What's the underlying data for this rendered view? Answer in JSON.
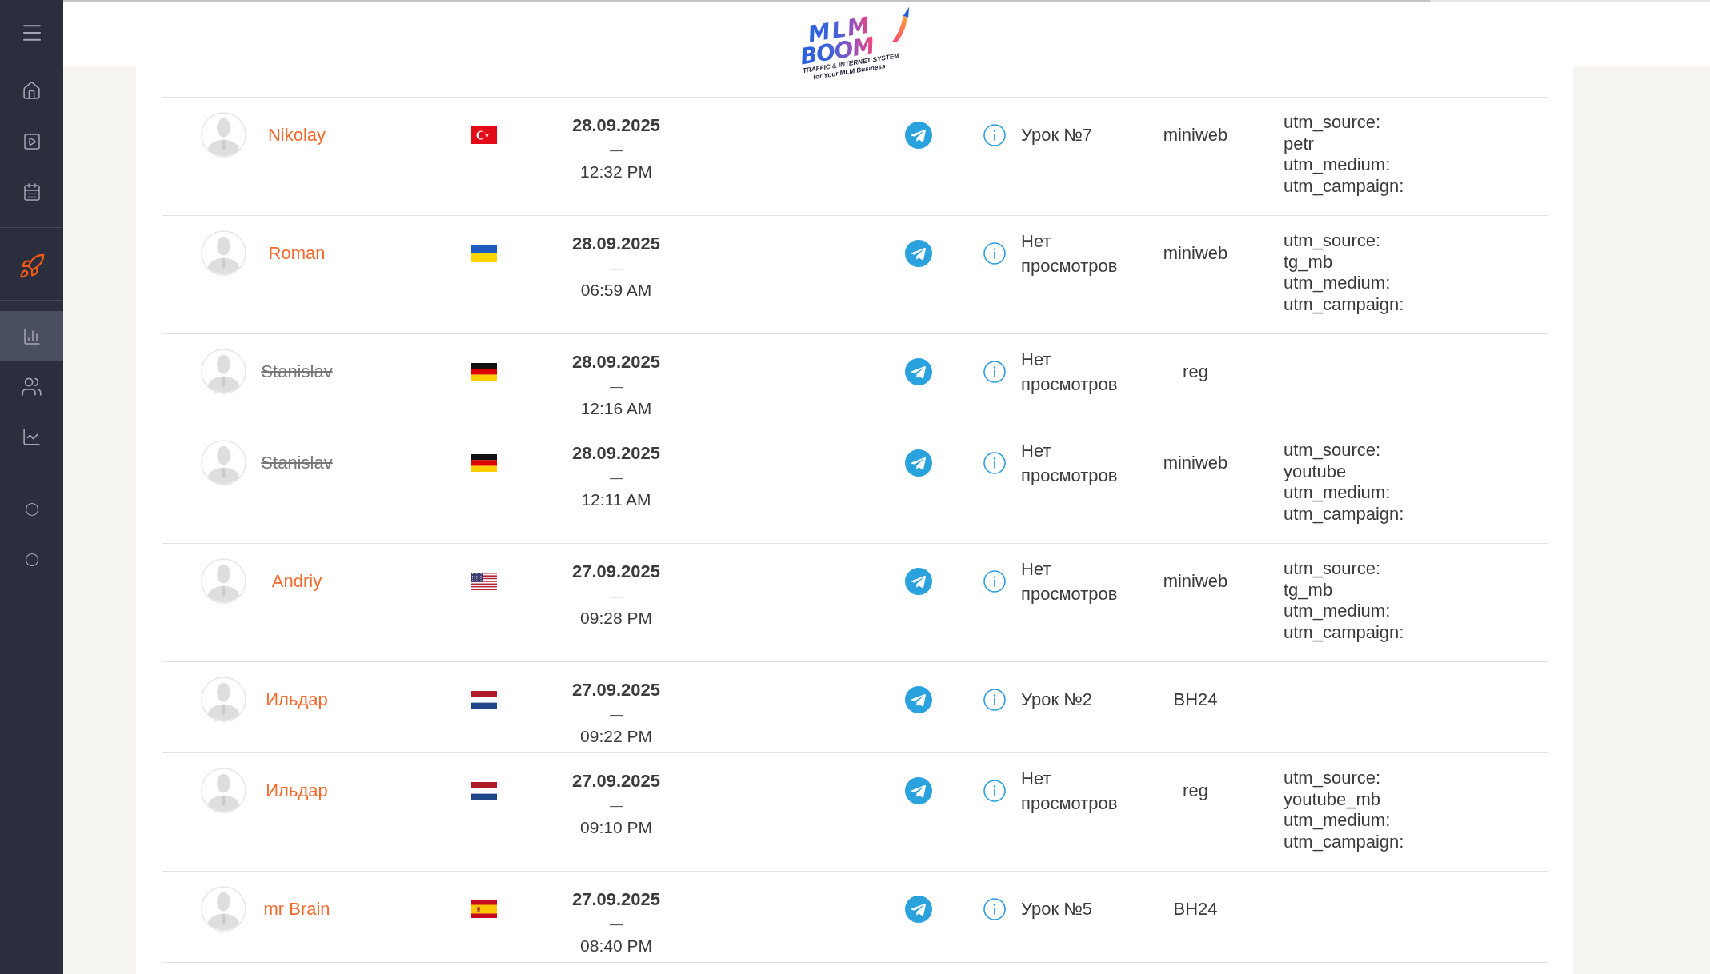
{
  "loading_bar": {
    "level": 0.83
  },
  "sidebar": {
    "groups": [
      {
        "items": [
          {
            "selected": false,
            "highlighted": false
          },
          {
            "selected": false,
            "highlighted": false
          },
          {
            "selected": false,
            "highlighted": false
          }
        ]
      },
      {
        "items": [
          {
            "selected": false,
            "highlighted": true
          }
        ]
      },
      {
        "items": [
          {
            "selected": true,
            "highlighted": false
          },
          {
            "selected": false,
            "highlighted": false
          },
          {
            "selected": false,
            "highlighted": false
          }
        ]
      },
      {
        "items": [
          {
            "selected": false,
            "highlighted": false
          },
          {
            "selected": false,
            "highlighted": false
          }
        ]
      }
    ]
  },
  "logo": {
    "line_1": "MLM",
    "line_2": "BOOM",
    "tagline_1": "TRAFFIC & INTERNET SYSTEM",
    "tagline_2": "for Your MLM Business"
  },
  "table": {
    "rows": [
      {
        "name": "Nikolay",
        "strikethrough": false,
        "flag": {
          "kind": "tr"
        },
        "date": "28.09.2025",
        "date_separator": "—",
        "time": "12:32 PM",
        "lesson": "Урок №7",
        "source": "miniweb",
        "utm": [
          {
            "label": "utm_source:",
            "value": "petr"
          },
          {
            "label": "utm_medium:"
          },
          {
            "label": "utm_campaign:"
          }
        ]
      },
      {
        "name": "Roman",
        "strikethrough": false,
        "flag": {
          "kind": "ua"
        },
        "date": "28.09.2025",
        "date_separator": "—",
        "time": "06:59 AM",
        "lesson": "Нет просмотров",
        "source": "miniweb",
        "utm": [
          {
            "label": "utm_source:",
            "value": "tg_mb"
          },
          {
            "label": "utm_medium:"
          },
          {
            "label": "utm_campaign:"
          }
        ]
      },
      {
        "name": "Stanislav",
        "strikethrough": true,
        "flag": {
          "kind": "de"
        },
        "date": "28.09.2025",
        "date_separator": "—",
        "time": "12:16 AM",
        "lesson": "Нет просмотров",
        "source": "reg"
      },
      {
        "name": "Stanislav",
        "strikethrough": true,
        "flag": {
          "kind": "de"
        },
        "date": "28.09.2025",
        "date_separator": "—",
        "time": "12:11 AM",
        "lesson": "Нет просмотров",
        "source": "miniweb",
        "utm": [
          {
            "label": "utm_source:",
            "value": "youtube"
          },
          {
            "label": "utm_medium:"
          },
          {
            "label": "utm_campaign:"
          }
        ]
      },
      {
        "name": "Andriy",
        "strikethrough": false,
        "flag": {
          "kind": "us"
        },
        "date": "27.09.2025",
        "date_separator": "—",
        "time": "09:28 PM",
        "lesson": "Нет просмотров",
        "source": "miniweb",
        "utm": [
          {
            "label": "utm_source:",
            "value": "tg_mb"
          },
          {
            "label": "utm_medium:"
          },
          {
            "label": "utm_campaign:"
          }
        ]
      },
      {
        "name": "Ильдар",
        "strikethrough": false,
        "flag": {
          "kind": "nl"
        },
        "date": "27.09.2025",
        "date_separator": "—",
        "time": "09:22 PM",
        "lesson": "Урок №2",
        "source": "BH24"
      },
      {
        "name": "Ильдар",
        "strikethrough": false,
        "flag": {
          "kind": "nl"
        },
        "date": "27.09.2025",
        "date_separator": "—",
        "time": "09:10 PM",
        "lesson": "Нет просмотров",
        "source": "reg",
        "utm": [
          {
            "label": "utm_source:",
            "value": "youtube_mb"
          },
          {
            "label": "utm_medium:"
          },
          {
            "label": "utm_campaign:"
          }
        ]
      },
      {
        "name": "mr Brain",
        "strikethrough": false,
        "flag": {
          "kind": "es"
        },
        "date": "27.09.2025",
        "date_separator": "—",
        "time": "08:40 PM",
        "lesson": "Урок №5",
        "source": "BH24"
      }
    ]
  }
}
